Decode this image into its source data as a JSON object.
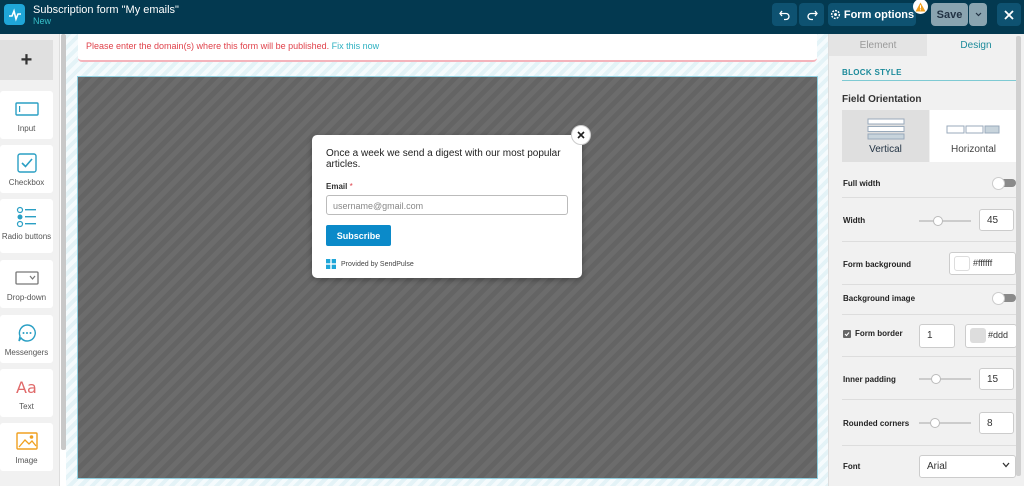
{
  "header": {
    "title": "Subscription form \"My emails\"",
    "subtitle": "New",
    "form_options_label": "Form options",
    "save_label": "Save"
  },
  "left_panel": {
    "add_label": "+",
    "tools": [
      {
        "label": "Input",
        "icon": "input-icon"
      },
      {
        "label": "Checkbox",
        "icon": "checkbox-icon"
      },
      {
        "label": "Radio buttons",
        "icon": "radio-buttons-icon"
      },
      {
        "label": "Drop-down",
        "icon": "dropdown-icon"
      },
      {
        "label": "Messengers",
        "icon": "messengers-icon"
      },
      {
        "label": "Text",
        "icon": "text-icon"
      },
      {
        "label": "Image",
        "icon": "image-icon"
      }
    ]
  },
  "warning": {
    "text": "Please enter the domain(s) where this form will be published.",
    "link": "Fix this now"
  },
  "popup": {
    "text": "Once a week we send a digest with our most popular articles.",
    "email_label": "Email",
    "required_mark": "*",
    "email_placeholder": "username@gmail.com",
    "subscribe_label": "Subscribe",
    "brand_text": "Provided by SendPulse"
  },
  "right_panel": {
    "tabs": [
      "Element",
      "Design"
    ],
    "active_tab": "Design",
    "section_title": "BLOCK STYLE",
    "field_orientation_title": "Field Orientation",
    "orientations": [
      "Vertical",
      "Horizontal"
    ],
    "selected_orientation": "Vertical",
    "full_width_label": "Full width",
    "full_width_on": false,
    "width_label": "Width",
    "width_value": "45",
    "form_background_label": "Form background",
    "form_background_value": "#ffffff",
    "background_image_label": "Background image",
    "background_image_on": false,
    "form_border_label": "Form border",
    "form_border_checked": true,
    "form_border_width": "1",
    "form_border_color": "#ddd",
    "inner_padding_label": "Inner padding",
    "inner_padding_value": "15",
    "rounded_corners_label": "Rounded corners",
    "rounded_corners_value": "8",
    "font_label": "Font",
    "font_value": "Arial"
  },
  "colors": {
    "topbar": "#033950",
    "accent": "#1b8a9a",
    "subscribe_button": "#0b8ac9",
    "warning_text": "#e0424b"
  }
}
